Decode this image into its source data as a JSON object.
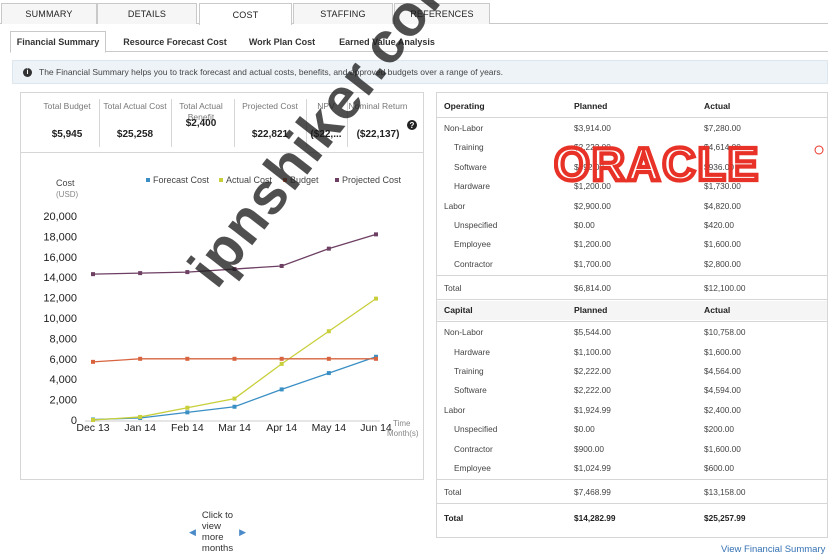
{
  "top_tabs": [
    {
      "label": "SUMMARY",
      "active": false
    },
    {
      "label": "DETAILS",
      "active": false
    },
    {
      "label": "COST",
      "active": true
    },
    {
      "label": "STAFFING",
      "active": false
    },
    {
      "label": "REFERENCES",
      "active": false
    }
  ],
  "sub_tabs": [
    {
      "label": "Financial Summary",
      "active": true
    },
    {
      "label": "Resource Forecast Cost",
      "active": false
    },
    {
      "label": "Work Plan Cost",
      "active": false
    },
    {
      "label": "Earned Value Analysis",
      "active": false
    }
  ],
  "info_text": "The Financial Summary helps you to track forecast and actual costs, benefits, and approved budgets over a range of years.",
  "kpis": [
    {
      "label": "Total Budget",
      "value": "$5,945"
    },
    {
      "label": "Total Actual Cost",
      "value": "$25,258"
    },
    {
      "label": "Total Actual Benefit",
      "value": "$2,400"
    },
    {
      "label": "Projected Cost",
      "value": "$22,821"
    },
    {
      "label": "NPV",
      "value": "($22,..."
    },
    {
      "label": "Nominal Return",
      "value": "($22,137)"
    }
  ],
  "help_icon": "?",
  "chart_data": {
    "type": "line",
    "ylabel": "Cost (USD)",
    "xlabel": "Time Month(s)",
    "categories": [
      "Dec 13",
      "Jan 14",
      "Feb 14",
      "Mar 14",
      "Apr 14",
      "May 14",
      "Jun 14"
    ],
    "ylim": [
      0,
      20000
    ],
    "yticks": [
      "0",
      "2,000",
      "4,000",
      "6,000",
      "8,000",
      "10,000",
      "12,000",
      "14,000",
      "16,000",
      "18,000",
      "20,000"
    ],
    "legend_position": "top-right",
    "grid": false,
    "series": [
      {
        "name": "Forecast Cost",
        "color": "#3a8fc4",
        "values": [
          50,
          200,
          750,
          1300,
          3000,
          4600,
          6200
        ]
      },
      {
        "name": "Actual Cost",
        "color": "#c8cf3a",
        "values": [
          0,
          300,
          1200,
          2100,
          5500,
          8700,
          11900
        ]
      },
      {
        "name": "Budget",
        "color": "#d8643f",
        "values": [
          5700,
          6000,
          6000,
          6000,
          6000,
          6000,
          6000
        ]
      },
      {
        "name": "Projected Cost",
        "color": "#6d3f63",
        "values": [
          14300,
          14400,
          14500,
          14800,
          15100,
          16800,
          18200
        ]
      }
    ]
  },
  "more_months": "Click to view more months",
  "operating": {
    "header": [
      "Operating",
      "Planned",
      "Actual"
    ],
    "rows": [
      {
        "label": "Non-Labor",
        "planned": "$3,914.00",
        "actual": "$7,280.00",
        "indent": false
      },
      {
        "label": "Training",
        "planned": "$2,222.00",
        "actual": "$4,614.00",
        "indent": true
      },
      {
        "label": "Software",
        "planned": "$492.00",
        "actual": "$936.00",
        "indent": true
      },
      {
        "label": "Hardware",
        "planned": "$1,200.00",
        "actual": "$1,730.00",
        "indent": true
      },
      {
        "label": "Labor",
        "planned": "$2,900.00",
        "actual": "$4,820.00",
        "indent": false
      },
      {
        "label": "Unspecified",
        "planned": "$0.00",
        "actual": "$420.00",
        "indent": true
      },
      {
        "label": "Employee",
        "planned": "$1,200.00",
        "actual": "$1,600.00",
        "indent": true
      },
      {
        "label": "Contractor",
        "planned": "$1,700.00",
        "actual": "$2,800.00",
        "indent": true
      }
    ],
    "total": {
      "label": "Total",
      "planned": "$6,814.00",
      "actual": "$12,100.00"
    }
  },
  "capital": {
    "header": [
      "Capital",
      "Planned",
      "Actual"
    ],
    "rows": [
      {
        "label": "Non-Labor",
        "planned": "$5,544.00",
        "actual": "$10,758.00",
        "indent": false
      },
      {
        "label": "Hardware",
        "planned": "$1,100.00",
        "actual": "$1,600.00",
        "indent": true
      },
      {
        "label": "Training",
        "planned": "$2,222.00",
        "actual": "$4,564.00",
        "indent": true
      },
      {
        "label": "Software",
        "planned": "$2,222.00",
        "actual": "$4,594.00",
        "indent": true
      },
      {
        "label": "Labor",
        "planned": "$1,924.99",
        "actual": "$2,400.00",
        "indent": false
      },
      {
        "label": "Unspecified",
        "planned": "$0.00",
        "actual": "$200.00",
        "indent": true
      },
      {
        "label": "Contractor",
        "planned": "$900.00",
        "actual": "$1,600.00",
        "indent": true
      },
      {
        "label": "Employee",
        "planned": "$1,024.99",
        "actual": "$600.00",
        "indent": true
      }
    ],
    "total": {
      "label": "Total",
      "planned": "$7,468.99",
      "actual": "$13,158.00"
    }
  },
  "grand_total": {
    "label": "Total",
    "planned": "$14,282.99",
    "actual": "$25,257.99"
  },
  "view_link": "View Financial Summary",
  "logo_text": "ORACLE",
  "watermark": "ipnshiker.com"
}
